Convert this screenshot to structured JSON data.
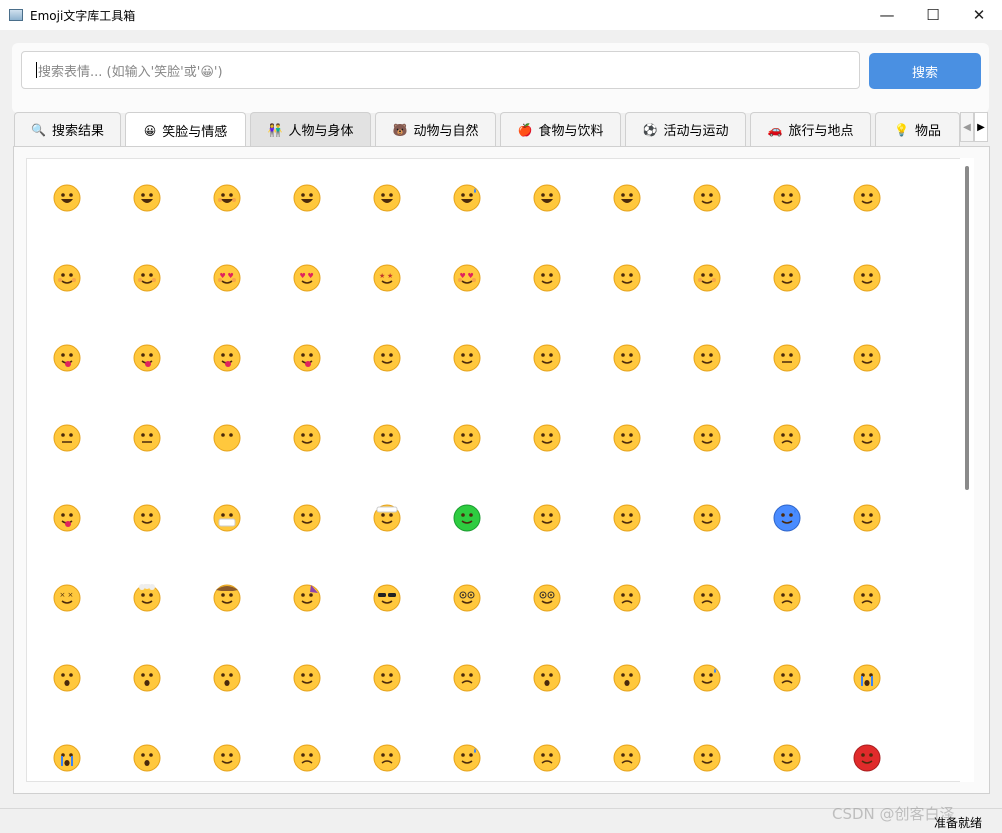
{
  "window": {
    "title": "Emoji文字库工具箱",
    "buttons": [
      "—",
      "☐",
      "✕"
    ]
  },
  "search": {
    "placeholder": "搜索表情... (如输入'笑脸'或'😀')",
    "button_label": "搜索"
  },
  "tabs": [
    {
      "label": "搜索结果",
      "icon": "🔍",
      "state": "normal"
    },
    {
      "label": "笑脸与情感",
      "icon": "😀",
      "state": "active"
    },
    {
      "label": "人物与身体",
      "icon": "👫",
      "state": "hover"
    },
    {
      "label": "动物与自然",
      "icon": "🐻",
      "state": "normal"
    },
    {
      "label": "食物与饮料",
      "icon": "🍎",
      "state": "normal"
    },
    {
      "label": "活动与运动",
      "icon": "⚽",
      "state": "normal"
    },
    {
      "label": "旅行与地点",
      "icon": "🚗",
      "state": "normal"
    },
    {
      "label": "物品",
      "icon": "💡",
      "state": "normal"
    }
  ],
  "tab_scroll": {
    "left": "◀",
    "right": "▶"
  },
  "emoji_grid": [
    [
      "grinning-face",
      "grinning-big-eyes",
      "grinning-smiling-eyes",
      "beaming-face",
      "grinning-squinting",
      "grinning-sweat",
      "rolling-laughing",
      "tears-of-joy",
      "slightly-smiling",
      "upside-down",
      "winking"
    ],
    [
      "smiling-eyes",
      "halo",
      "hearts",
      "heart-eyes",
      "star-struck",
      "kissing-heart",
      "kissing",
      "kissing-closed-eyes",
      "kissing-smiling-eyes",
      "holding-back-tears",
      "savoring-food"
    ],
    [
      "tongue",
      "winking-tongue",
      "zany",
      "squinting-tongue",
      "money-mouth",
      "hugging",
      "hand-over-mouth",
      "peeking",
      "thinking",
      "zipper-mouth",
      "raised-eyebrow"
    ],
    [
      "neutral",
      "expressionless",
      "no-mouth",
      "smirking",
      "unamused",
      "rolling-eyes",
      "grimacing",
      "lying",
      "relieved",
      "pensive",
      "sleepy"
    ],
    [
      "drooling",
      "sleeping",
      "medical-mask",
      "thermometer",
      "head-bandage",
      "nauseated",
      "vomiting",
      "sneezing",
      "hot-face",
      "cold-face",
      "woozy"
    ],
    [
      "crossed-out-eyes",
      "exploding-head",
      "cowboy",
      "partying",
      "sunglasses",
      "nerd",
      "monocle",
      "confused",
      "worried",
      "slightly-frowning",
      "frowning"
    ],
    [
      "open-mouth",
      "hushed",
      "astonished",
      "flushed",
      "pleading",
      "frowning-open-mouth",
      "anguished",
      "fearful",
      "anxious-sweat",
      "sad-relieved",
      "crying"
    ],
    [
      "loudly-crying",
      "screaming",
      "confounded",
      "persevering",
      "disappointed",
      "downcast-sweat",
      "weary",
      "tired",
      "yawning",
      "steam-nose",
      "angry-red"
    ]
  ],
  "colors": {
    "accent": "#4a90e2",
    "face": "#ffc83d",
    "face_outline": "#e5a21a",
    "feature": "#4b2a0c",
    "tongue": "#e0245e",
    "blush": "#f28c52",
    "green_face": "#2ecc40",
    "blue_face": "#4a8cff",
    "red_face": "#e02b2b"
  },
  "status": {
    "text": "准备就绪"
  },
  "watermark": "CSDN @创客白泽"
}
